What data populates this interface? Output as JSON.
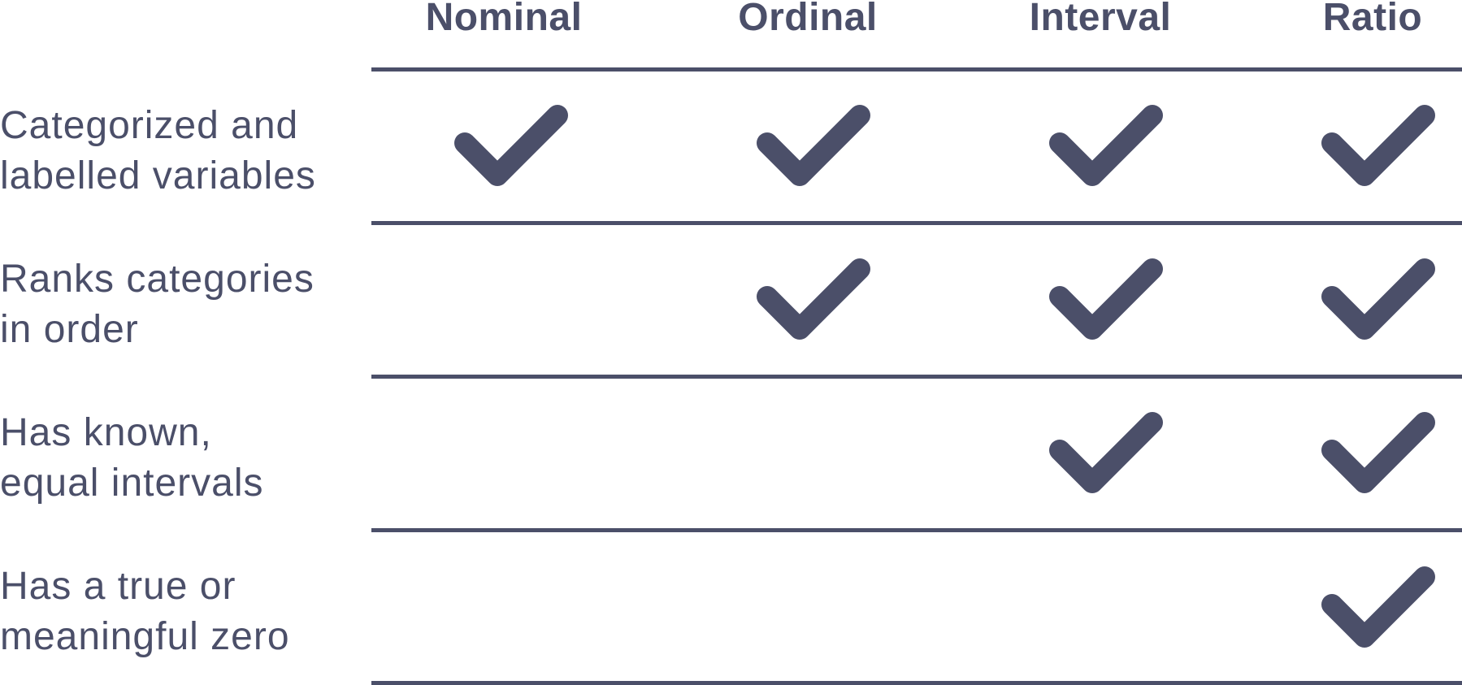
{
  "columns": [
    "Nominal",
    "Ordinal",
    "Interval",
    "Ratio"
  ],
  "rows": [
    {
      "line1": "Categorized and",
      "line2": "labelled variables",
      "checks": [
        true,
        true,
        true,
        true
      ]
    },
    {
      "line1": "Ranks categories",
      "line2": "in order",
      "checks": [
        false,
        true,
        true,
        true
      ]
    },
    {
      "line1": "Has known,",
      "line2": "equal intervals",
      "checks": [
        false,
        false,
        true,
        true
      ]
    },
    {
      "line1": "Has a true or",
      "line2": "meaningful zero",
      "checks": [
        false,
        false,
        false,
        true
      ]
    }
  ],
  "colors": {
    "ink": "#4b4f69",
    "background": "#ffffff"
  },
  "icon": "checkmark-icon"
}
